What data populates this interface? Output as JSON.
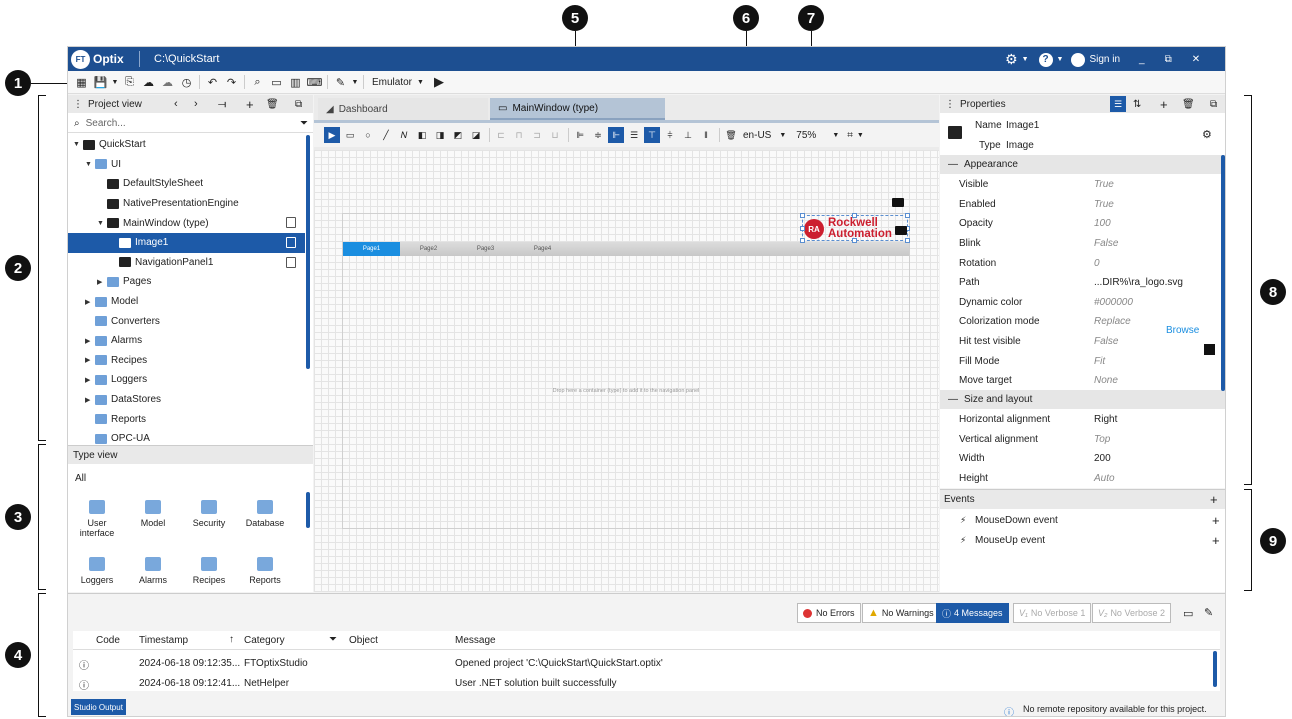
{
  "titlebar": {
    "app_name": "Optix",
    "logo_badge": "FT",
    "path": "C:\\QuickStart",
    "sign_in": "Sign in",
    "minimize": "_",
    "restore": "⧉",
    "close": "✕"
  },
  "toolbar": {
    "emulator_label": "Emulator"
  },
  "project_view": {
    "title": "Project view",
    "search_placeholder": "Search...",
    "tree": [
      {
        "label": "QuickStart",
        "indent": 0,
        "caret": "▼",
        "icon": "project-icon"
      },
      {
        "label": "UI",
        "indent": 1,
        "caret": "▼",
        "icon": "ui-folder-icon"
      },
      {
        "label": "DefaultStyleSheet",
        "indent": 2,
        "caret": "",
        "icon": "stylesheet-icon"
      },
      {
        "label": "NativePresentationEngine",
        "indent": 2,
        "caret": "",
        "icon": "gear-icon"
      },
      {
        "label": "MainWindow (type)",
        "indent": 2,
        "caret": "▼",
        "icon": "window-icon",
        "end": true
      },
      {
        "label": "Image1",
        "indent": 3,
        "caret": "",
        "icon": "image-icon",
        "end": true,
        "selected": true
      },
      {
        "label": "NavigationPanel1",
        "indent": 3,
        "caret": "",
        "icon": "navpanel-icon",
        "end": true
      },
      {
        "label": "Pages",
        "indent": 2,
        "caret": "▶",
        "icon": "folder-icon"
      },
      {
        "label": "Model",
        "indent": 1,
        "caret": "▶",
        "icon": "model-folder-icon"
      },
      {
        "label": "Converters",
        "indent": 1,
        "caret": "",
        "icon": "converters-folder-icon"
      },
      {
        "label": "Alarms",
        "indent": 1,
        "caret": "▶",
        "icon": "alarms-folder-icon"
      },
      {
        "label": "Recipes",
        "indent": 1,
        "caret": "▶",
        "icon": "recipes-folder-icon"
      },
      {
        "label": "Loggers",
        "indent": 1,
        "caret": "▶",
        "icon": "loggers-folder-icon"
      },
      {
        "label": "DataStores",
        "indent": 1,
        "caret": "▶",
        "icon": "datastores-folder-icon"
      },
      {
        "label": "Reports",
        "indent": 1,
        "caret": "",
        "icon": "reports-folder-icon"
      },
      {
        "label": "OPC-UA",
        "indent": 1,
        "caret": "",
        "icon": "opcua-folder-icon"
      }
    ]
  },
  "type_view": {
    "title": "Type view",
    "filter": "All",
    "items": [
      {
        "label": "User interface"
      },
      {
        "label": "Model"
      },
      {
        "label": "Security"
      },
      {
        "label": "Database"
      },
      {
        "label": "Loggers"
      },
      {
        "label": "Alarms"
      },
      {
        "label": "Recipes"
      },
      {
        "label": "Reports"
      }
    ]
  },
  "editor": {
    "tabs": [
      {
        "label": "Dashboard",
        "active": false
      },
      {
        "label": "MainWindow (type)",
        "active": true
      }
    ],
    "locale": "en-US",
    "zoom": "75%",
    "pages": [
      "Page1",
      "Page2",
      "Page3",
      "Page4"
    ],
    "drop_hint": "Drop here a container (type) to add it to the navigation panel",
    "logo_line1": "Rockwell",
    "logo_line2": "Automation",
    "logo_badge": "RA"
  },
  "properties": {
    "title": "Properties",
    "name_label": "Name",
    "name_value": "Image1",
    "type_label": "Type",
    "type_value": "Image",
    "sections": {
      "appearance": "Appearance",
      "size_layout": "Size and layout"
    },
    "appearance": [
      {
        "name": "Visible",
        "value": "True",
        "solid": false
      },
      {
        "name": "Enabled",
        "value": "True",
        "solid": false
      },
      {
        "name": "Opacity",
        "value": "100",
        "solid": false
      },
      {
        "name": "Blink",
        "value": "False",
        "solid": false
      },
      {
        "name": "Rotation",
        "value": "0",
        "solid": false
      },
      {
        "name": "Path",
        "value": "...DIR%\\ra_logo.svg",
        "solid": true
      },
      {
        "name": "Dynamic color",
        "value": "#000000",
        "solid": false
      },
      {
        "name": "Colorization mode",
        "value": "Replace",
        "solid": false
      },
      {
        "name": "Hit test visible",
        "value": "False",
        "solid": false
      },
      {
        "name": "Fill Mode",
        "value": "Fit",
        "solid": false
      },
      {
        "name": "Move target",
        "value": "None",
        "solid": false
      }
    ],
    "browse": "Browse",
    "size_layout": [
      {
        "name": "Horizontal alignment",
        "value": "Right",
        "solid": true
      },
      {
        "name": "Vertical alignment",
        "value": "Top",
        "solid": false
      },
      {
        "name": "Width",
        "value": "200",
        "solid": true
      },
      {
        "name": "Height",
        "value": "Auto",
        "solid": false
      }
    ]
  },
  "events": {
    "title": "Events",
    "items": [
      {
        "label": "MouseDown event"
      },
      {
        "label": "MouseUp event"
      }
    ]
  },
  "output": {
    "filters": {
      "errors": "No Errors",
      "warnings": "No Warnings",
      "messages": "4 Messages",
      "verbose1": "No Verbose 1",
      "verbose2": "No Verbose 2"
    },
    "columns": {
      "code": "Code",
      "timestamp": "Timestamp",
      "category": "Category",
      "object": "Object",
      "message": "Message"
    },
    "rows": [
      {
        "timestamp": "2024-06-18 09:12:35...",
        "category": "FTOptixStudio",
        "object": "",
        "message": "Opened project 'C:\\QuickStart\\QuickStart.optix'"
      },
      {
        "timestamp": "2024-06-18 09:12:41...",
        "category": "NetHelper",
        "object": "",
        "message": "User .NET solution built successfully"
      }
    ],
    "tab_label": "Studio Output",
    "status": "No remote repository available for this project."
  },
  "callouts": [
    "1",
    "2",
    "3",
    "4",
    "5",
    "6",
    "7",
    "8",
    "9"
  ],
  "colors": {
    "brand": "#1d4f91",
    "accent": "#1d5aa8",
    "page_tab": "#1a8ee0",
    "ra_red": "#cc1f2f"
  }
}
